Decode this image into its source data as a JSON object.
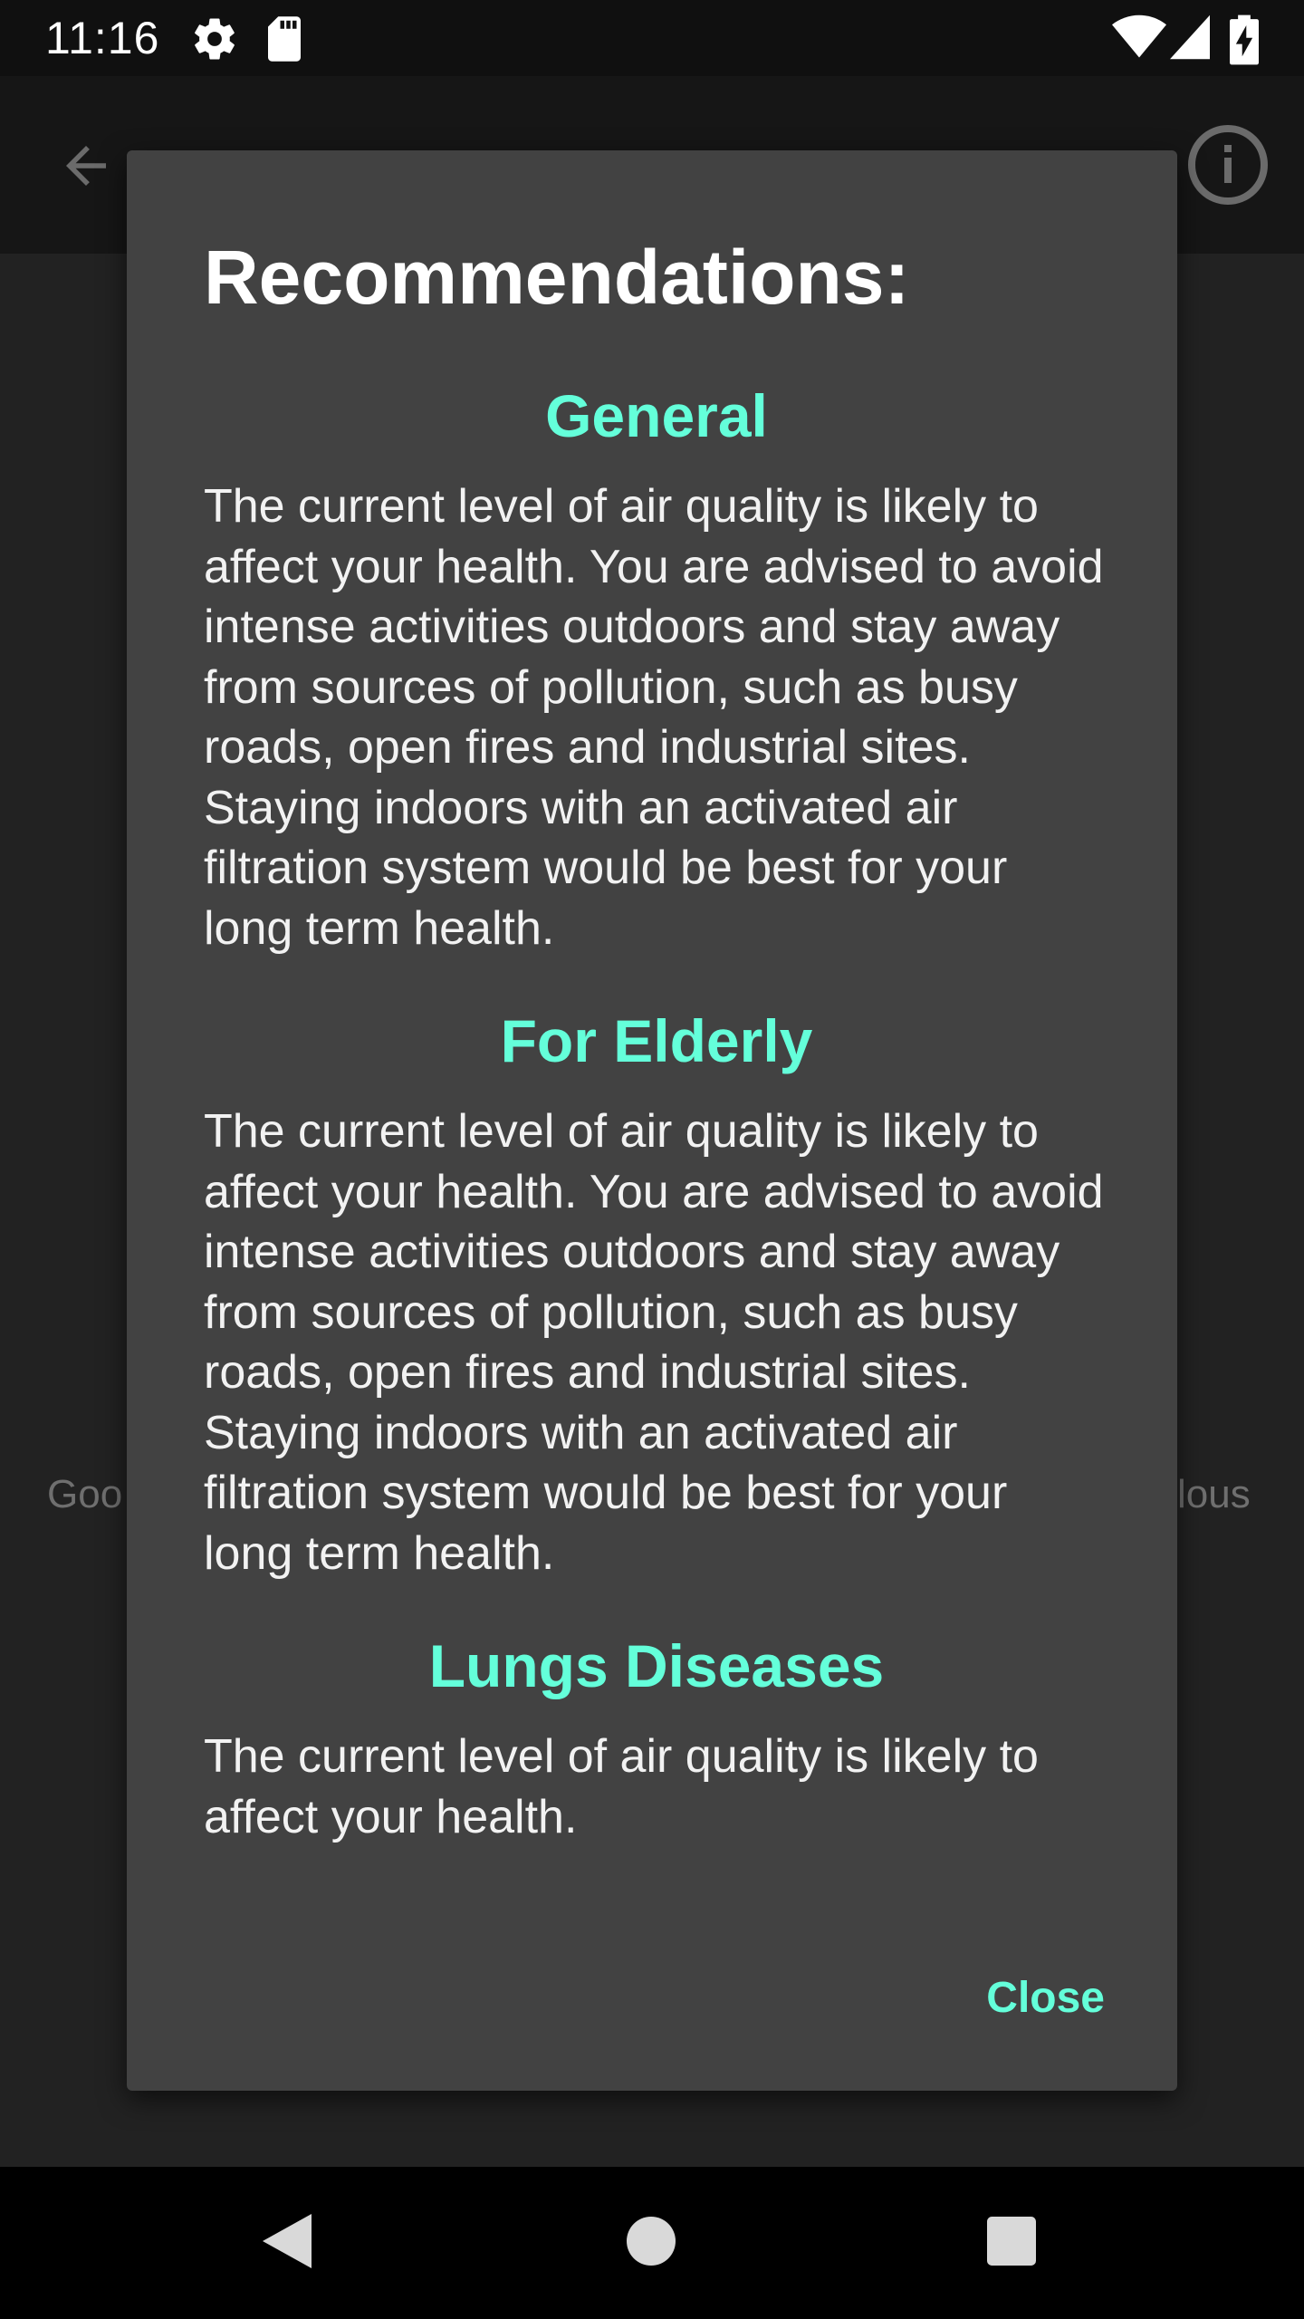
{
  "status_bar": {
    "time": "11:16",
    "icons": [
      "settings-icon",
      "sd-card-icon",
      "wifi-icon",
      "signal-icon",
      "battery-charging-icon"
    ]
  },
  "app_bar": {
    "icons": [
      "back-arrow-icon",
      "info-icon"
    ]
  },
  "background": {
    "left_label": "Goo",
    "right_label": "lous"
  },
  "dialog": {
    "title": "Recommendations:",
    "sections": [
      {
        "heading": "General",
        "body": "The current level of air quality is likely to affect your health. You are advised to avoid intense activities outdoors and stay away from sources of pollution, such as busy roads, open fires and industrial sites. Staying indoors with an activated air filtration system would be best for your long term health."
      },
      {
        "heading": "For Elderly",
        "body": "The current level of air quality is likely to affect your health. You are advised to avoid intense activities outdoors and stay away from sources of pollution, such as busy roads, open fires and industrial sites. Staying indoors with an activated air filtration system would be best for your long term health."
      },
      {
        "heading": "Lungs Diseases",
        "body": "The current level of air quality is likely to affect your health."
      }
    ],
    "close_label": "Close"
  },
  "nav_bar": {
    "icons": [
      "nav-back-icon",
      "nav-home-icon",
      "nav-recents-icon"
    ]
  },
  "colors": {
    "accent": "#64ffda",
    "dialog_bg": "#424242",
    "text": "#f2f2f2"
  }
}
